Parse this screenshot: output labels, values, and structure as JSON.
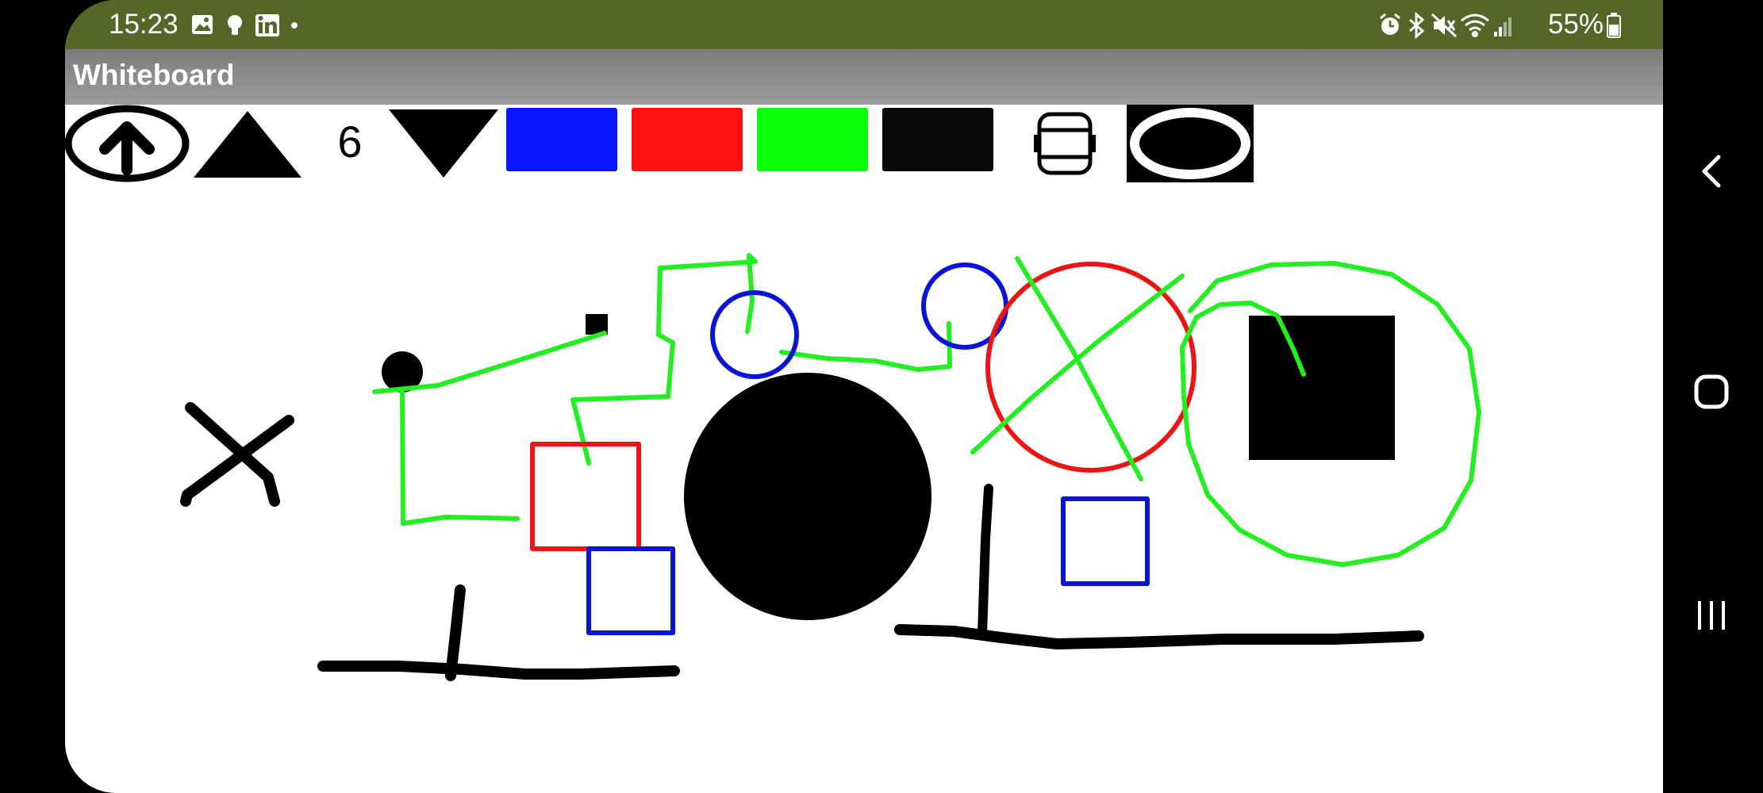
{
  "status_bar": {
    "time": "15:23",
    "notification_icons": [
      "image-icon",
      "lightbulb-icon",
      "linkedin-icon",
      "dot-icon"
    ],
    "system_icons": [
      "alarm-icon",
      "bluetooth-icon",
      "mute-icon",
      "wifi-icon",
      "signal-icon"
    ],
    "battery": "55%"
  },
  "app": {
    "title": "Whiteboard"
  },
  "toolbar": {
    "upload_icon": "arrow-up-circle-icon",
    "increase_icon": "triangle-up-icon",
    "size_value": "6",
    "decrease_icon": "triangle-down-icon",
    "colors": [
      {
        "name": "blue",
        "hex": "#0a14ff"
      },
      {
        "name": "red",
        "hex": "#ff1010"
      },
      {
        "name": "green",
        "hex": "#0aff0a"
      },
      {
        "name": "black",
        "hex": "#0a0a0a"
      }
    ],
    "eraser_icon": "eraser-icon",
    "shape_icon": "ellipse-icon"
  },
  "colors": {
    "status_bar": "#566628",
    "title_bar": "#8c8c8c",
    "stroke_green": "#22ee22",
    "stroke_blue": "#0a14d8",
    "stroke_red": "#ee1414",
    "stroke_black": "#000000"
  },
  "nav_bar": {
    "icons": [
      "back-icon",
      "home-icon",
      "recents-icon"
    ]
  }
}
